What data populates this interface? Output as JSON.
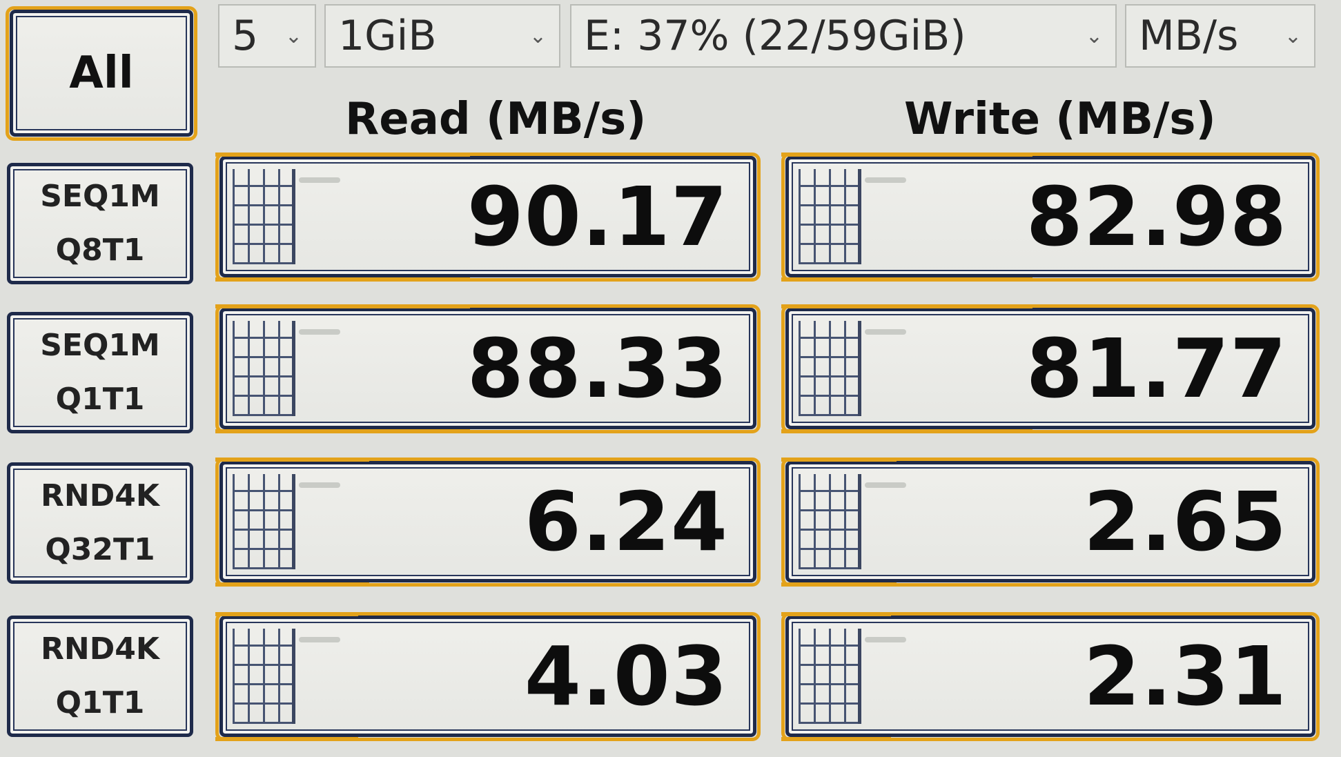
{
  "toolbar": {
    "all_label": "All",
    "count": "5",
    "size": "1GiB",
    "drive": "E: 37% (22/59GiB)",
    "unit": "MB/s"
  },
  "headers": {
    "read": "Read (MB/s)",
    "write": "Write (MB/s)"
  },
  "tests": [
    {
      "line1": "SEQ1M",
      "line2": "Q8T1",
      "read": "90.17",
      "write": "82.98",
      "read_fill": 0.48,
      "write_fill": 0.48
    },
    {
      "line1": "SEQ1M",
      "line2": "Q1T1",
      "read": "88.33",
      "write": "81.77",
      "read_fill": 0.48,
      "write_fill": 0.48
    },
    {
      "line1": "RND4K",
      "line2": "Q32T1",
      "read": "6.24",
      "write": "2.65",
      "read_fill": 0.29,
      "write_fill": 0.22
    },
    {
      "line1": "RND4K",
      "line2": "Q1T1",
      "read": "4.03",
      "write": "2.31",
      "read_fill": 0.27,
      "write_fill": 0.21
    }
  ],
  "colors": {
    "accent": "#e3a21a",
    "frame": "#1e2a4a"
  }
}
